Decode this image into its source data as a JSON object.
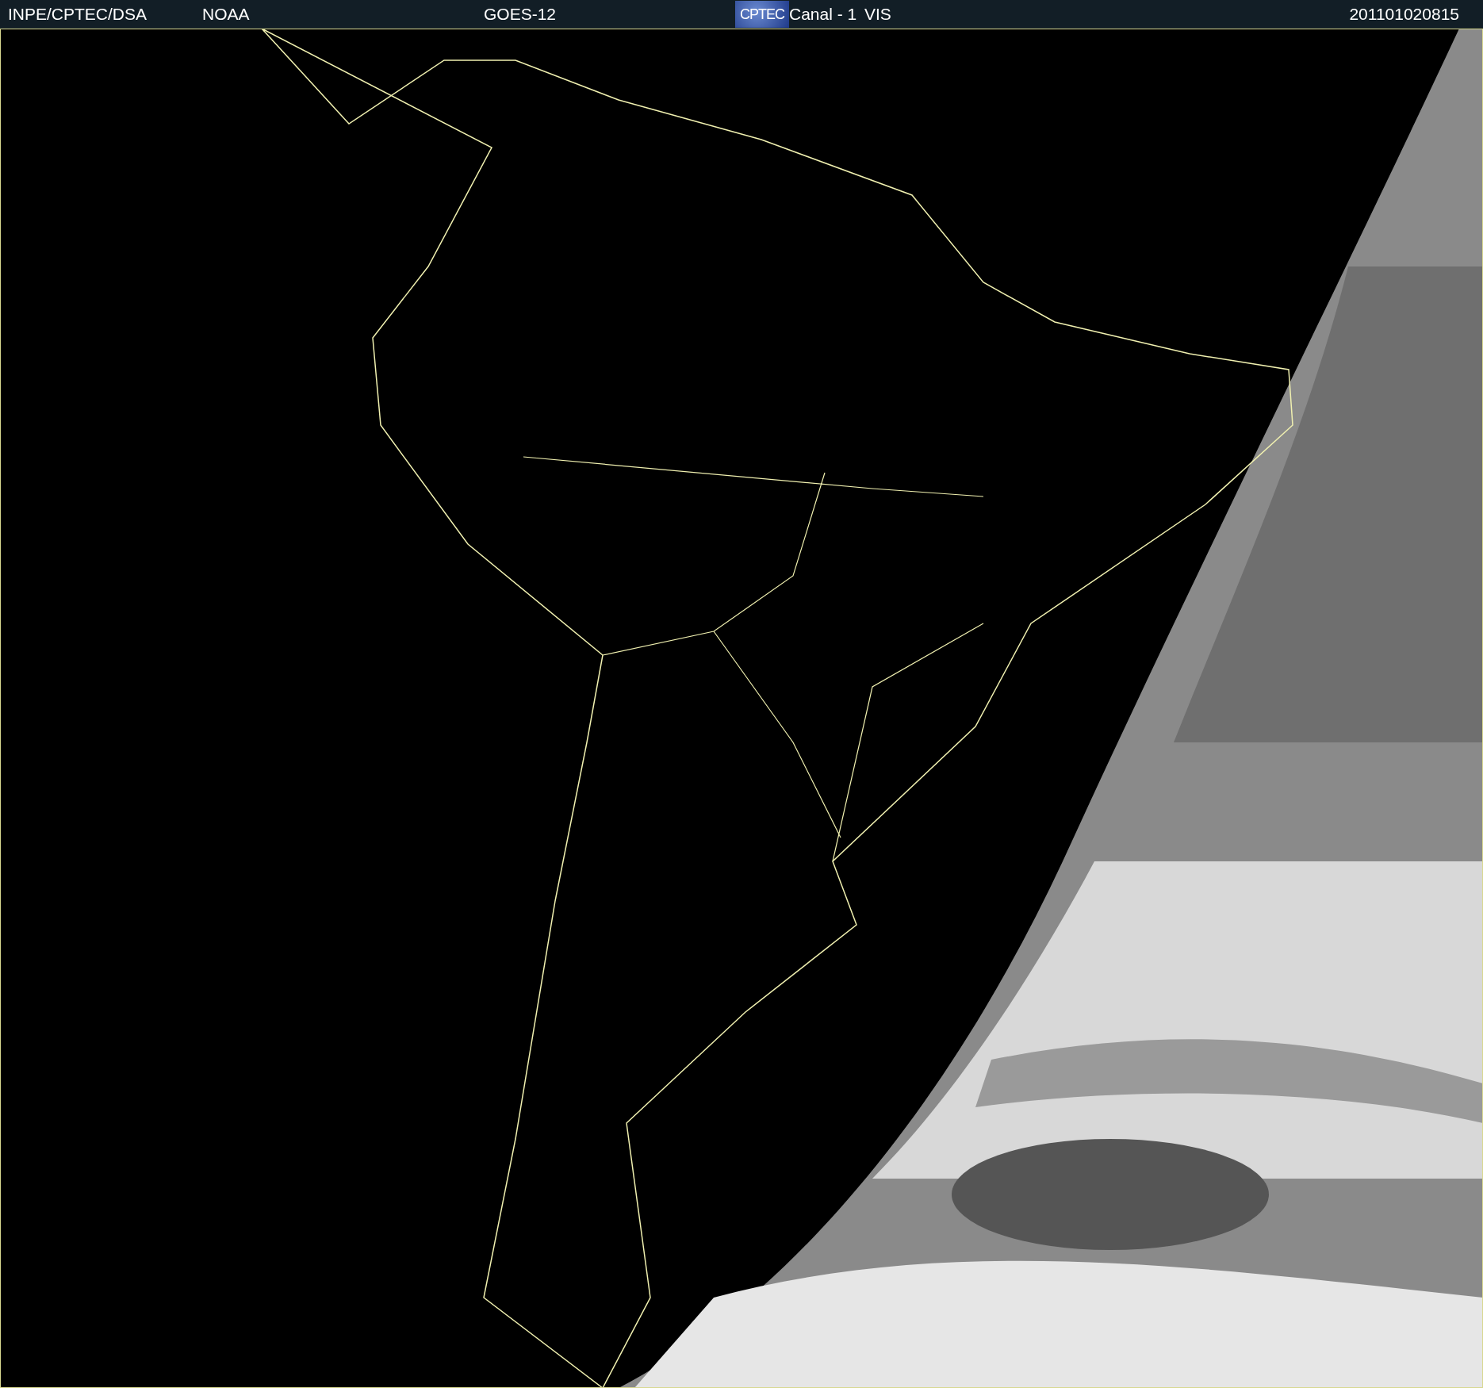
{
  "header": {
    "source": "INPE/CPTEC/DSA",
    "agency": "NOAA",
    "satellite": "GOES-12",
    "logo_text": "CPTEC",
    "channel": "Canal - 1",
    "band": "VIS",
    "timestamp": "201101020815"
  }
}
